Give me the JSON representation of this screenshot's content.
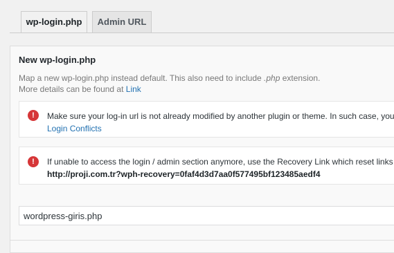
{
  "tabs": [
    {
      "label": "wp-login.php",
      "active": true
    },
    {
      "label": "Admin URL",
      "active": false
    }
  ],
  "section": {
    "title": "New wp-login.php",
    "desc_prefix": "Map a new wp-login.php instead default. This also need to include ",
    "desc_em": ".php",
    "desc_suffix": " extension.",
    "desc2_prefix": "More details can be found at ",
    "desc2_link": "Link"
  },
  "notices": [
    {
      "icon": "error-icon",
      "line1": "Make sure your log-in url is not already modified by another plugin or theme. In such case, you",
      "link": "Login Conflicts"
    },
    {
      "icon": "error-icon",
      "line1": "If unable to access the login / admin section anymore, use the Recovery Link which reset links to",
      "url": "http://proji.com.tr?wph-recovery=0faf4d3d7aa0f577495bf123485aedf4"
    }
  ],
  "input": {
    "value": "wordpress-giris.php"
  },
  "colors": {
    "error": "#d63638",
    "link": "#2271b1"
  }
}
